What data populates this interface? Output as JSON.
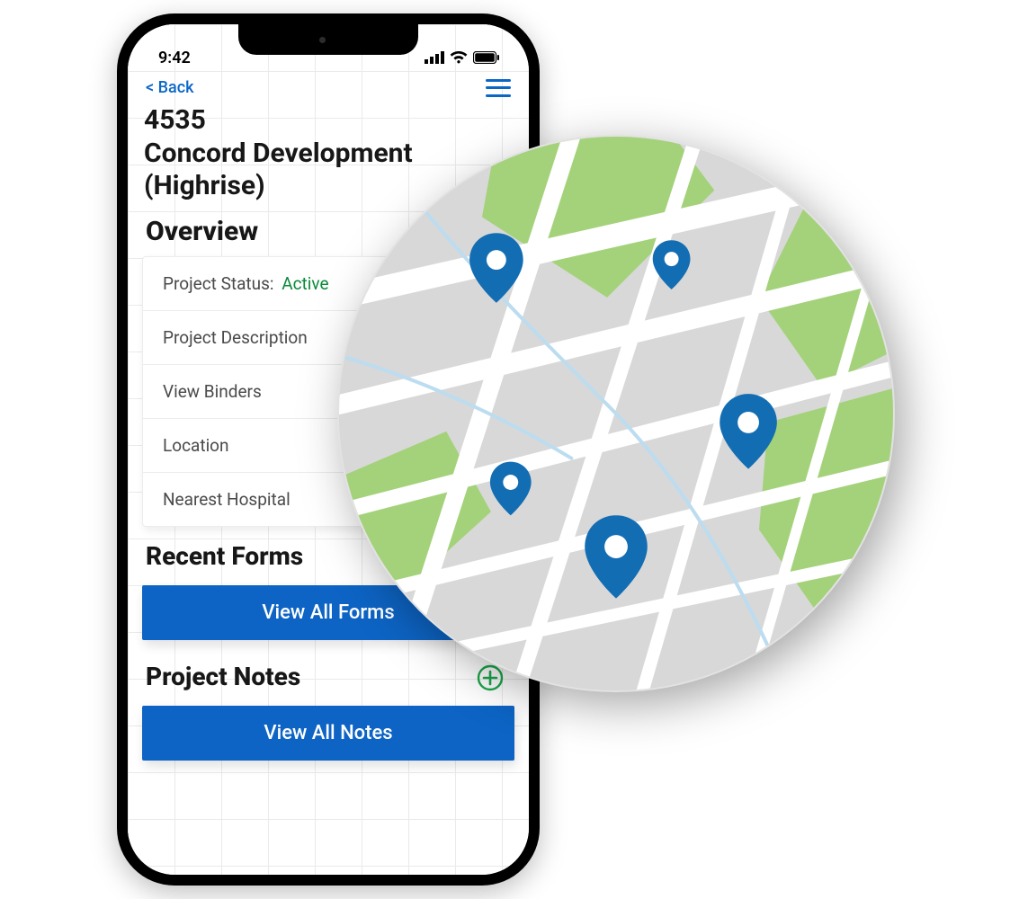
{
  "statusbar": {
    "time": "9:42"
  },
  "topbar": {
    "back_label": "< Back"
  },
  "project": {
    "number": "4535",
    "name_line1": "Concord Development",
    "name_line2": "(Highrise)"
  },
  "overview": {
    "title": "Overview",
    "status_label": "Project Status:",
    "status_value": "Active",
    "items": [
      "Project Description",
      "View Binders",
      "Location",
      "Nearest Hospital"
    ]
  },
  "recent_forms": {
    "title": "Recent Forms",
    "view_all_label": "View All Forms"
  },
  "project_notes": {
    "title": "Project Notes",
    "view_all_label": "View All Notes"
  },
  "colors": {
    "accent": "#0d64c4",
    "active": "#0a8a3b",
    "map_green": "#a4d27a",
    "map_gray": "#d8d8d8",
    "pin": "#136db3"
  }
}
